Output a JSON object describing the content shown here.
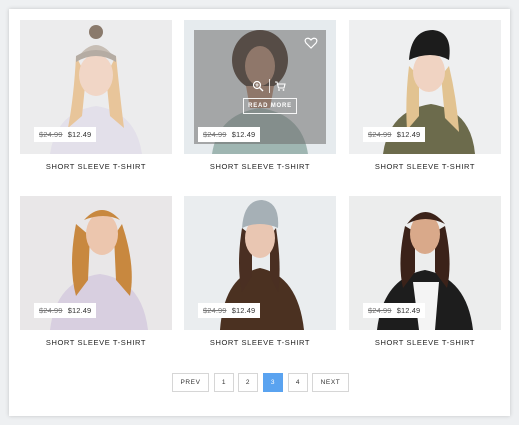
{
  "products": [
    {
      "title": "SHORT SLEEVE T-SHIRT",
      "old_price": "$24.99",
      "price": "$12.49",
      "bg": "#ececed",
      "top": "#e3e0ea",
      "hair": "#e8c59a",
      "hat": "#c7beb5",
      "skin": "#f1d6c6"
    },
    {
      "title": "SHORT SLEEVE T-SHIRT",
      "old_price": "$24.99",
      "price": "$12.49",
      "bg": "#e6ebee",
      "top": "#9fb6b2",
      "hair": "#3a2418",
      "hat": "",
      "skin": "#b98466",
      "hover": true,
      "read_more": "READ MORE"
    },
    {
      "title": "SHORT SLEEVE T-SHIRT",
      "old_price": "$24.99",
      "price": "$12.49",
      "bg": "#eeeff0",
      "top": "#6c6b4c",
      "hair": "#e2c391",
      "hat": "#1c1c1c",
      "skin": "#f0d3c2"
    },
    {
      "title": "SHORT SLEEVE T-SHIRT",
      "old_price": "$24.99",
      "price": "$12.49",
      "bg": "#e9e7e8",
      "top": "#d8cfe0",
      "hair": "#c8883f",
      "hat": "",
      "skin": "#ecc6ae"
    },
    {
      "title": "SHORT SLEEVE T-SHIRT",
      "old_price": "$24.99",
      "price": "$12.49",
      "bg": "#eaedef",
      "top": "#4b3121",
      "hair": "#4a2f22",
      "hat": "#a6b0b6",
      "skin": "#e9c6b2"
    },
    {
      "title": "SHORT SLEEVE T-SHIRT",
      "old_price": "$24.99",
      "price": "$12.49",
      "bg": "#eceded",
      "top": "#1d1d1d",
      "hair": "#3b2219",
      "hat": "",
      "skin": "#d9a98a"
    }
  ],
  "pagination": {
    "prev": "PREV",
    "next": "NEXT",
    "pages": [
      "1",
      "2",
      "3",
      "4"
    ],
    "active": "3",
    "accent": "#5aa3f0"
  }
}
